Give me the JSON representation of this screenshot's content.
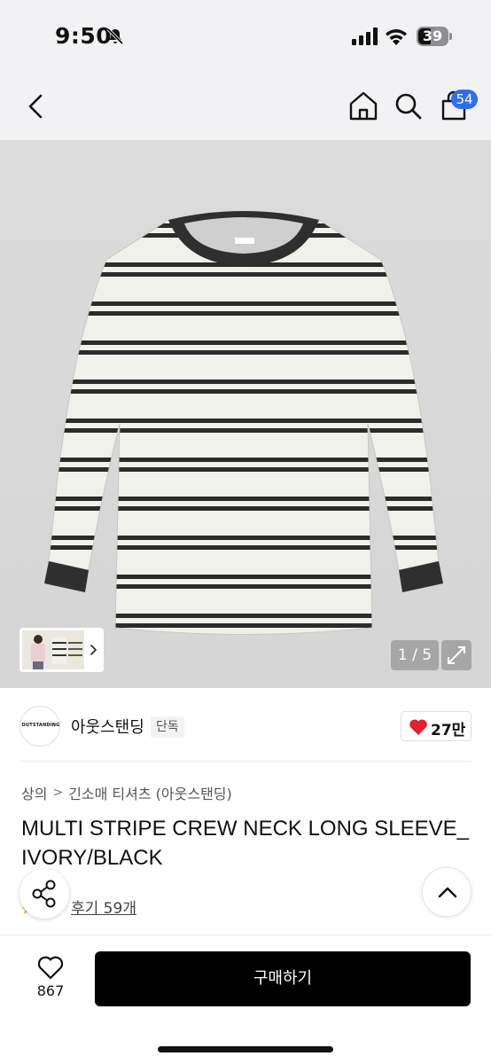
{
  "status_bar": {
    "time": "9:50",
    "battery": "39"
  },
  "nav": {
    "cart_count": "54"
  },
  "gallery": {
    "page_counter": "1 / 5",
    "current_page": 1,
    "total_pages": 5
  },
  "brand": {
    "logo_text": "OUTSTANDING",
    "name": "아웃스탠딩",
    "badge": "단독",
    "likes": "27만"
  },
  "breadcrumb": {
    "category": "상의",
    "subcategory": "긴소매 티셔츠 (아웃스탠딩)",
    "separator": ">"
  },
  "product": {
    "title": "MULTI STRIPE CREW NECK LONG SLEEVE_IVORY/BLACK",
    "reviews": "후기 59개"
  },
  "bottom": {
    "wish_count": "867",
    "buy_label": "구매하기"
  },
  "colors": {
    "accent": "#2f6df6",
    "like": "#e3202f",
    "buy_bg": "#000000"
  }
}
